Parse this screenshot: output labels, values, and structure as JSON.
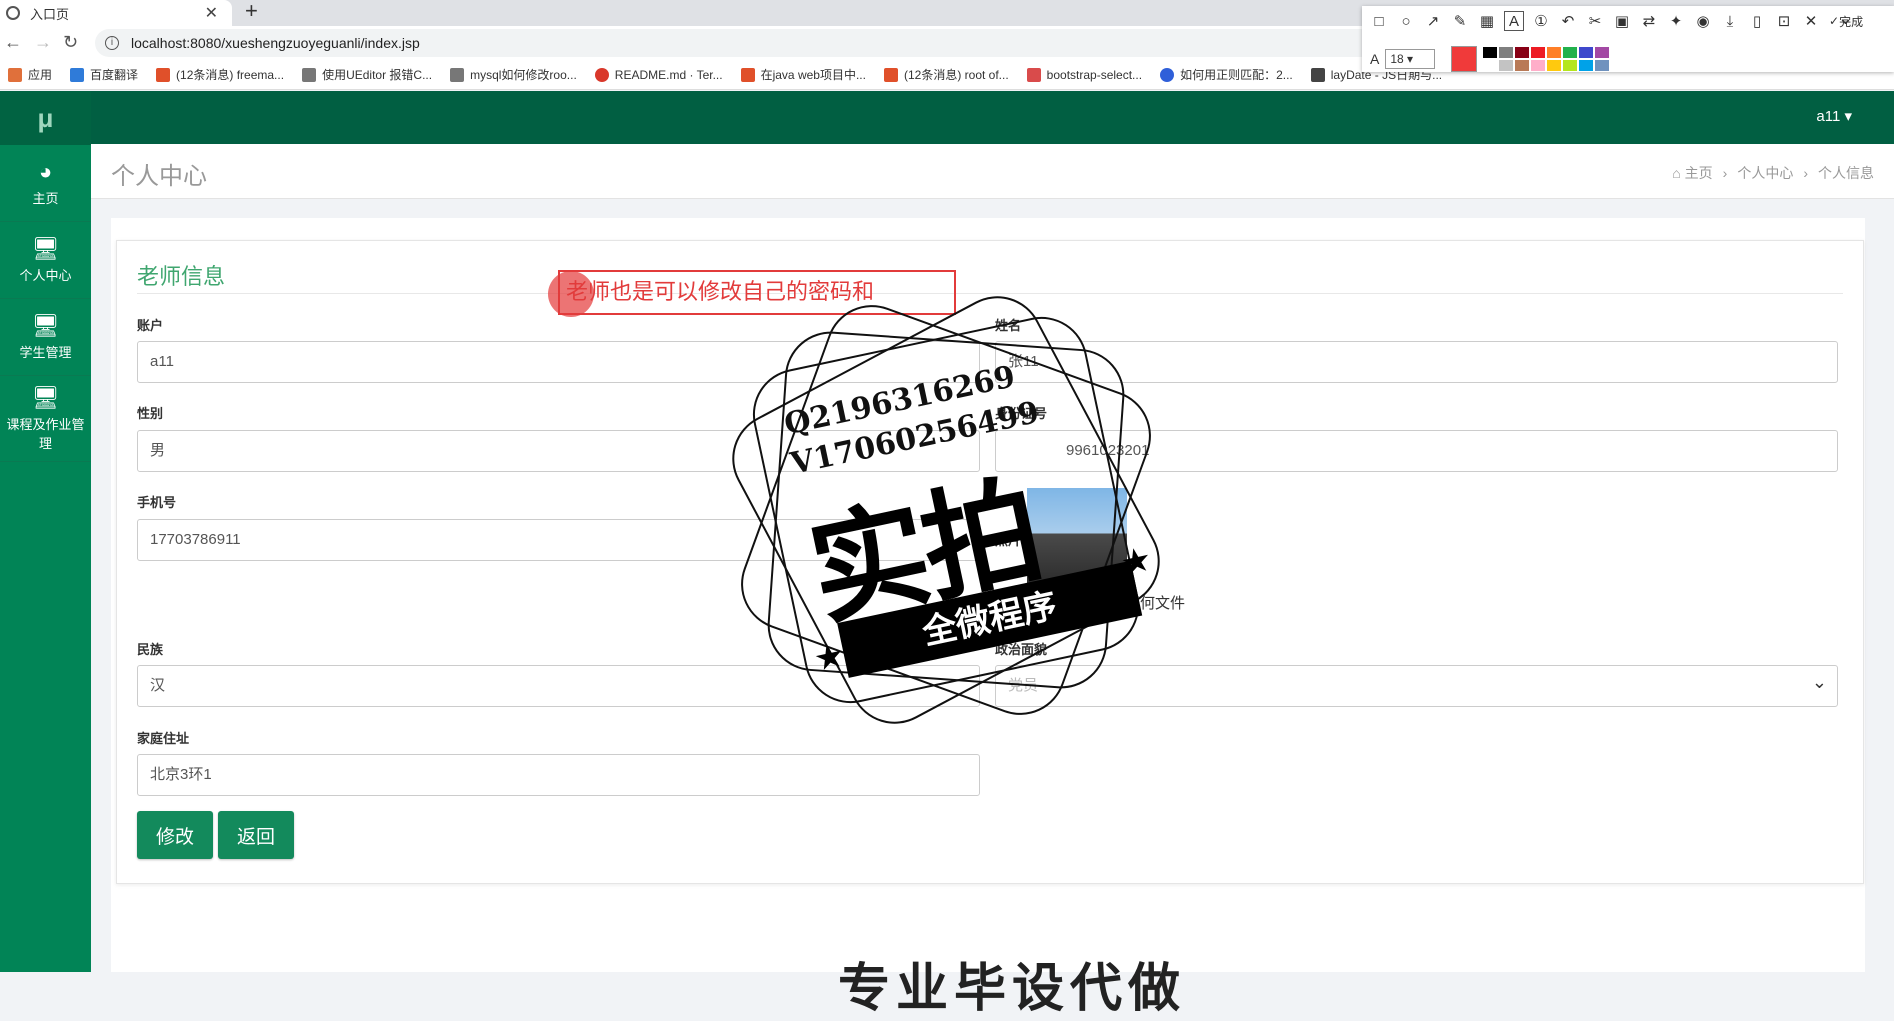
{
  "browser": {
    "tab_title": "入口页",
    "url": "localhost:8080/xueshengzuoyeguanli/index.jsp",
    "bookmarks": [
      {
        "label": "应用",
        "color": "#e0703b"
      },
      {
        "label": "百度翻译",
        "color": "#2f7bd9"
      },
      {
        "label": "(12条消息) freema...",
        "color": "#e0502a"
      },
      {
        "label": "使用UEditor 报错C...",
        "color": "#777777"
      },
      {
        "label": "mysql如何修改roo...",
        "color": "#777777"
      },
      {
        "label": "README.md · Ter...",
        "color": "#d9382b"
      },
      {
        "label": "在java web项目中...",
        "color": "#e0502a"
      },
      {
        "label": "(12条消息) root of...",
        "color": "#e0502a"
      },
      {
        "label": "bootstrap-select...",
        "color": "#d94b4b"
      },
      {
        "label": "如何用正则匹配：2...",
        "color": "#2f5fd9"
      },
      {
        "label": "layDate - JS日期与...",
        "color": "#444444"
      }
    ]
  },
  "snip_toolbar": {
    "done_label": "完成",
    "font_size": "18",
    "current_color": "#f03a3a",
    "palette": [
      "#000000",
      "#7f7f7f",
      "#880015",
      "#ed1c24",
      "#ff7f27",
      "#22b14c",
      "#3f48cc",
      "#a349a4",
      "#ffffff",
      "#c3c3c3",
      "#b97a57",
      "#ffaec9",
      "#ffc90e",
      "#b5e61d",
      "#00a2e8",
      "#7092be"
    ]
  },
  "app": {
    "logo": "μ",
    "user_menu": "a11",
    "sidebar": [
      {
        "label": "主页",
        "icon": "dashboard-icon"
      },
      {
        "label": "个人中心",
        "icon": "monitor-icon"
      },
      {
        "label": "学生管理",
        "icon": "monitor-icon"
      },
      {
        "label": "课程及作业管理",
        "icon": "monitor-icon"
      }
    ],
    "page_title": "个人中心",
    "breadcrumb": [
      "主页",
      "个人中心",
      "个人信息"
    ]
  },
  "form": {
    "title": "老师信息",
    "account_label": "账户",
    "account_value": "a11",
    "name_label": "姓名",
    "name_value": "张11",
    "gender_label": "性别",
    "gender_value": "男",
    "idcard_label": "身份证号",
    "idcard_value": "9961023201",
    "phone_label": "手机号",
    "phone_value": "17703786911",
    "photo_label": "照片",
    "file_hint": "未选择任何文件",
    "nation_label": "民族",
    "nation_value": "汉",
    "politics_label": "政治面貌",
    "politics_value": "党员",
    "address_label": "家庭住址",
    "address_value": "北京3环1",
    "submit_label": "修改",
    "back_label": "返回"
  },
  "overlay": {
    "annotation_text": "老师也是可以修改自己的密码和",
    "watermark_q": "Q2196316269",
    "watermark_v": "V17060256499",
    "watermark_big": "实拍",
    "watermark_ribbon": "全微程序",
    "bottom_text": "专业毕设代做"
  }
}
